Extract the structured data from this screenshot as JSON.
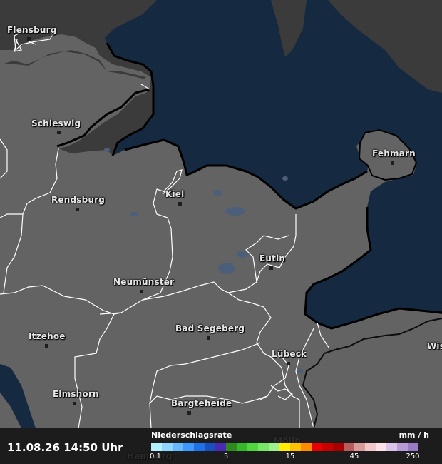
{
  "map": {
    "cities": [
      {
        "name": "Flensburg",
        "label_name": "city-label-flensburg"
      },
      {
        "name": "Schleswig",
        "label_name": "city-label-schleswig"
      },
      {
        "name": "Fehmarn",
        "label_name": "city-label-fehmarn"
      },
      {
        "name": "Kiel",
        "label_name": "city-label-kiel"
      },
      {
        "name": "Rendsburg",
        "label_name": "city-label-rendsburg"
      },
      {
        "name": "Eutin",
        "label_name": "city-label-eutin"
      },
      {
        "name": "Neumünster",
        "label_name": "city-label-neumuenster"
      },
      {
        "name": "Itzehoe",
        "label_name": "city-label-itzehoe"
      },
      {
        "name": "Bad Segeberg",
        "label_name": "city-label-bad-segeberg"
      },
      {
        "name": "Lübeck",
        "label_name": "city-label-luebeck"
      },
      {
        "name": "Wis",
        "label_name": "city-label-wismar"
      },
      {
        "name": "Elmshorn",
        "label_name": "city-label-elmshorn"
      },
      {
        "name": "Bargteheide",
        "label_name": "city-label-bargteheide"
      },
      {
        "name": "Mölln",
        "label_name": "city-label-moelln"
      },
      {
        "name": "Hamburg",
        "label_name": "city-label-hamburg"
      }
    ],
    "colors": {
      "land": "#636363",
      "sea": "#152a40",
      "outside": "#3b3b3b",
      "lakes": "#4b5f78",
      "borders": "#ffffff"
    }
  },
  "footer": {
    "timestamp": "11.08.26 14:50 Uhr",
    "legend_title": "Niederschlagsrate",
    "legend_unit": "mm / h",
    "legend_colors": [
      "#b5f0ff",
      "#8ed6ff",
      "#66b9ff",
      "#3f98ff",
      "#1f71e6",
      "#1a4fc2",
      "#4a2ab2",
      "#2d8a1f",
      "#37b82a",
      "#52d63f",
      "#76e866",
      "#9ef08e",
      "#ffee00",
      "#ffc100",
      "#ff8a00",
      "#e60000",
      "#c90000",
      "#a80000",
      "#b85c5c",
      "#d99a9a",
      "#f2c7c7",
      "#ffdfe8",
      "#d9c3e8",
      "#b99ad6",
      "#9a7ac6"
    ],
    "legend_ticks": [
      {
        "label": "0.1",
        "index": 0
      },
      {
        "label": "5",
        "index": 7
      },
      {
        "label": "15",
        "index": 13
      },
      {
        "label": "45",
        "index": 19
      },
      {
        "label": "250",
        "index": 25
      }
    ]
  }
}
